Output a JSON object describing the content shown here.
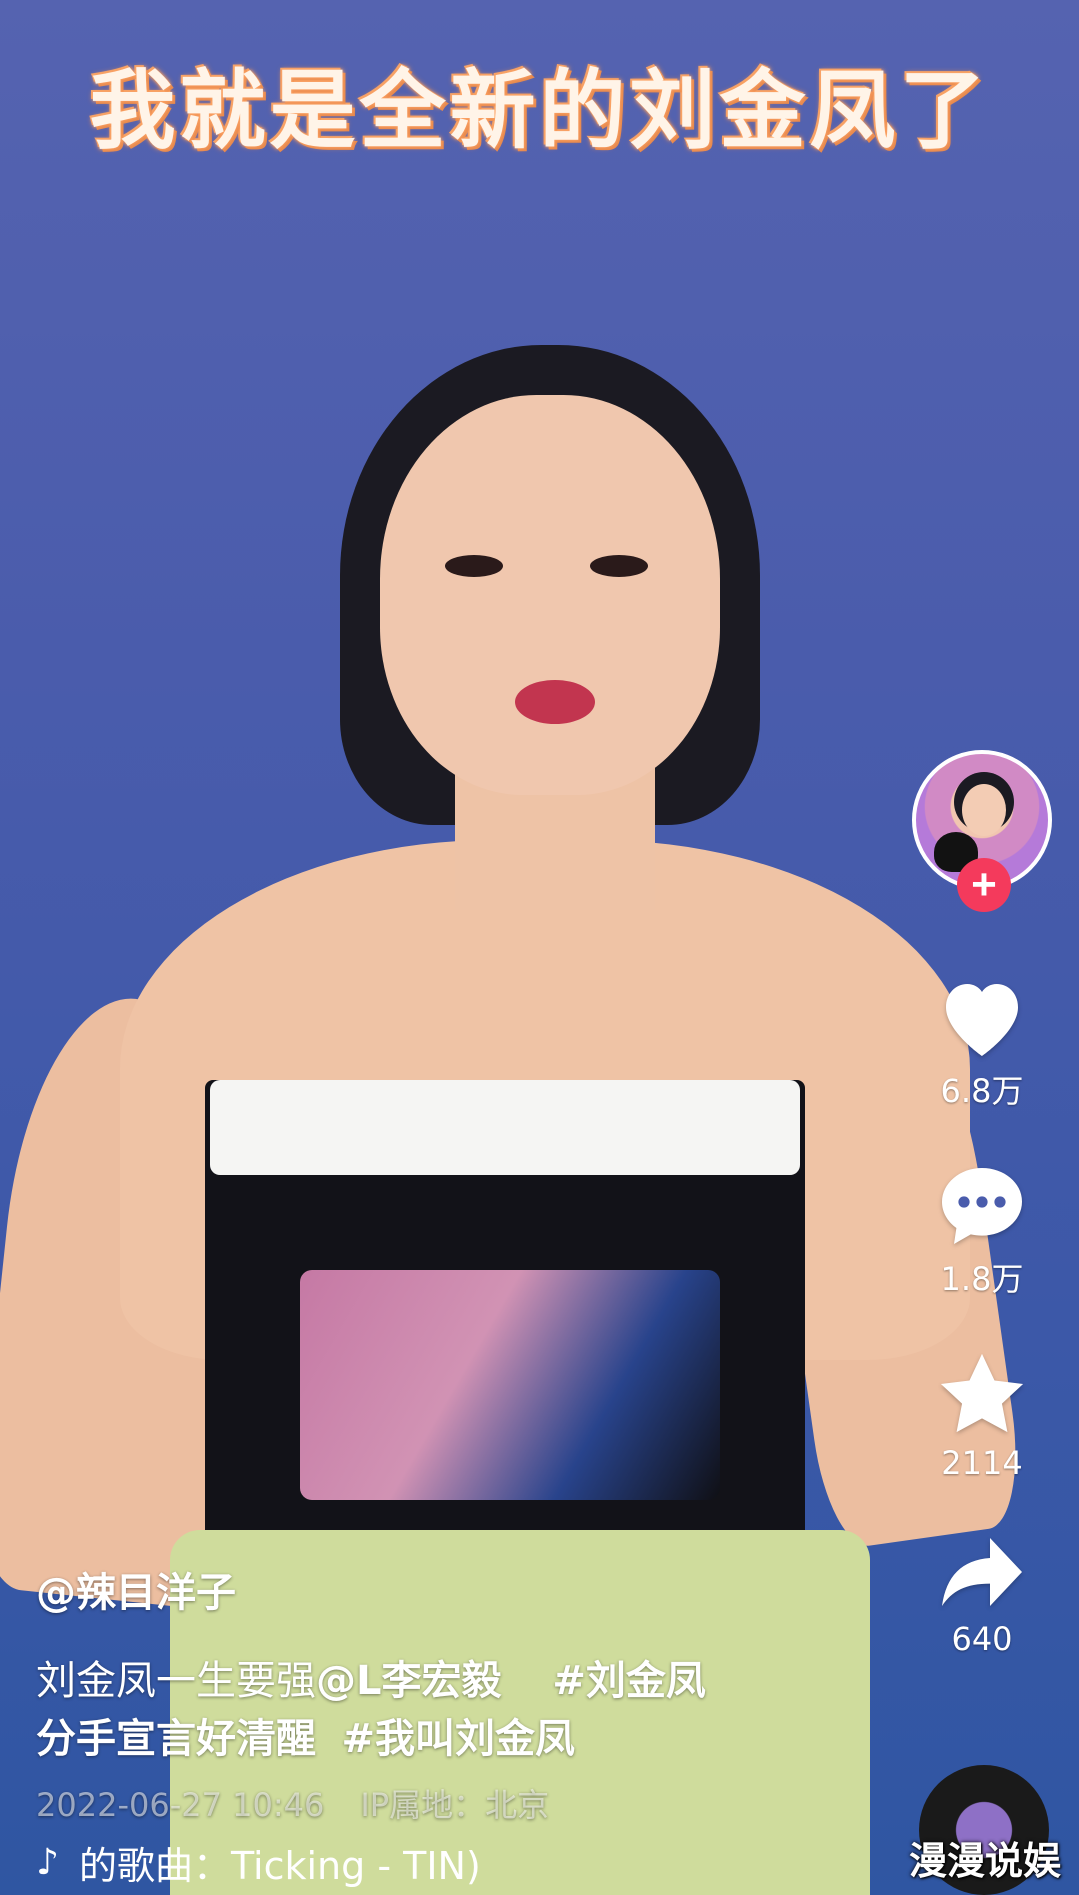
{
  "overlay_caption": "我就是全新的刘金凤了",
  "creator": {
    "avatar_icon": "creator-avatar",
    "follow_label": "+"
  },
  "actions": {
    "like": {
      "icon": "heart-icon",
      "count": "6.8万"
    },
    "comment": {
      "icon": "comment-bubble-icon",
      "count": "1.8万"
    },
    "favorite": {
      "icon": "star-icon",
      "count": "2114"
    },
    "share": {
      "icon": "share-arrow-icon",
      "count": "640"
    }
  },
  "post": {
    "username": "@辣目洋子",
    "desc_line1_text": "刘金凤一生要强",
    "desc_mention": "@L李宏毅",
    "desc_tag1": "#刘金凤",
    "desc_line2_text": "分手宣言好清醒",
    "desc_tag2": "#我叫刘金凤",
    "date": "2022-06-27  10:46",
    "ip": "IP属地：北京"
  },
  "music": {
    "icon": "tiktok-note-icon",
    "label": "的歌曲：Ticking  -  TIN)"
  },
  "watermark": "漫漫说娱",
  "colors": {
    "background": "#4a5cac",
    "follow_button": "#f43a5c",
    "caption_glow": "#f39050"
  }
}
